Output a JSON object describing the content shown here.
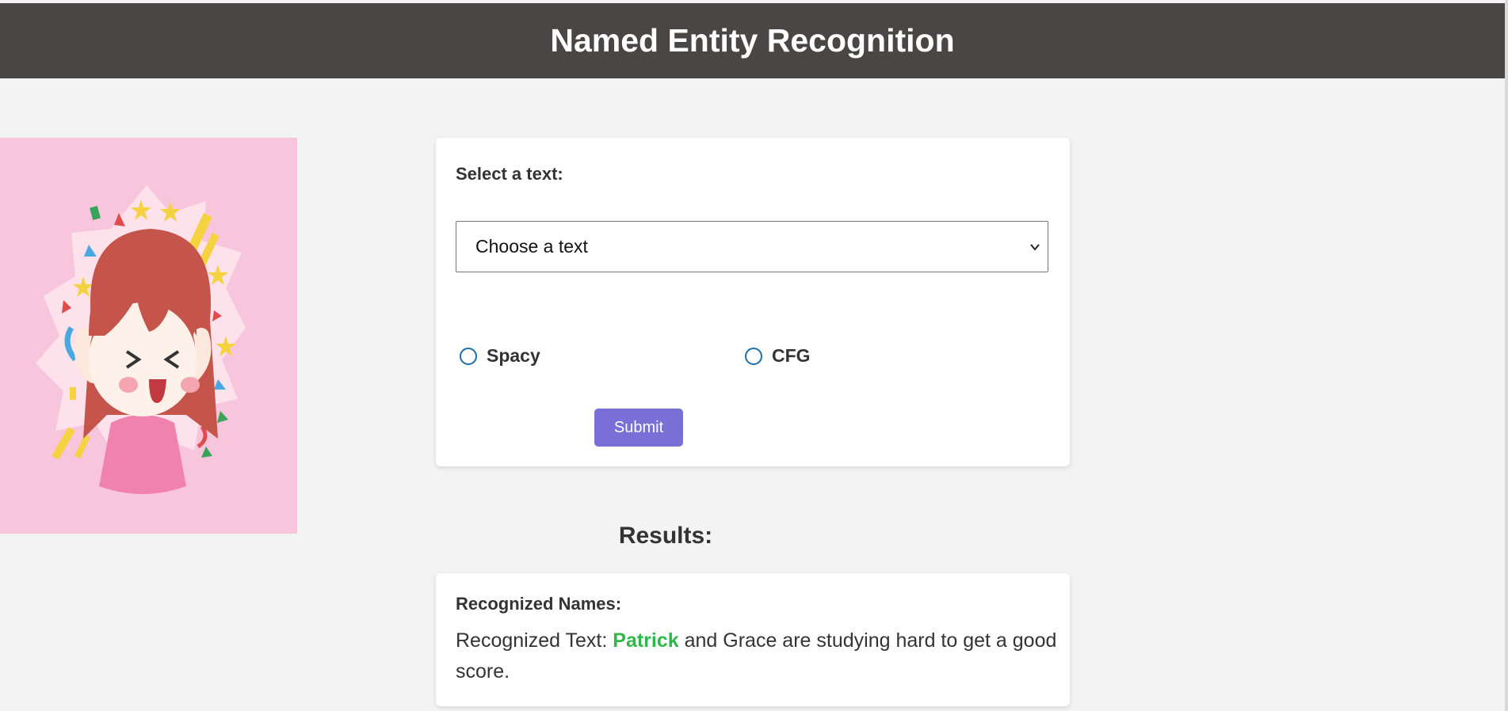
{
  "header": {
    "title": "Named Entity Recognition"
  },
  "form": {
    "label": "Select a text:",
    "select_value": "Choose a text",
    "radios": [
      {
        "label": "Spacy",
        "checked": false
      },
      {
        "label": "CFG",
        "checked": false
      }
    ],
    "submit_label": "Submit"
  },
  "results": {
    "heading": "Results:",
    "names_label": "Recognized Names:",
    "text_prefix": "Recognized Text:",
    "entity": "Patrick",
    "text_rest": "and Grace are studying hard to get a good score."
  },
  "colors": {
    "header_bg": "#4a4646",
    "accent_button": "#7a6fd6",
    "entity_highlight": "#2fb84a",
    "illustration_bg": "#f7c6dc"
  }
}
